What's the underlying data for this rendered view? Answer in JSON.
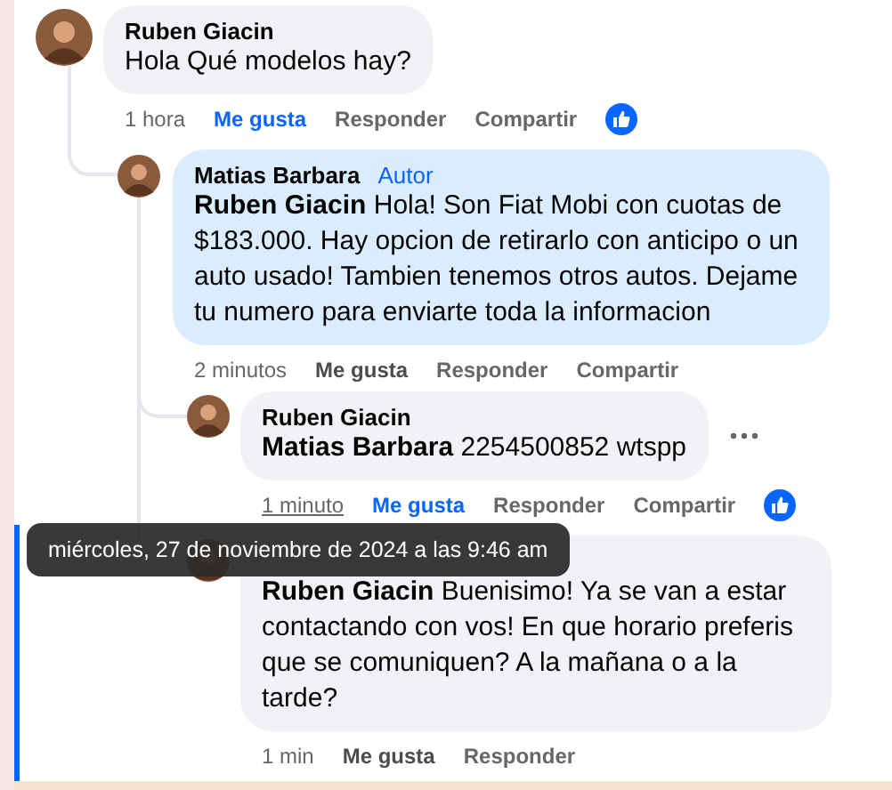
{
  "comments": [
    {
      "author": "Ruben Giacin",
      "text": "Hola Qué modelos hay?",
      "highlighted": false,
      "time": "1 hora",
      "time_hovered": false,
      "actions": [
        {
          "label": "Me gusta",
          "kind": "like",
          "active": true
        },
        {
          "label": "Responder",
          "kind": "reply"
        },
        {
          "label": "Compartir",
          "kind": "share"
        }
      ],
      "reaction": true,
      "menu": false,
      "focused": false,
      "children": [
        {
          "author": "Matias Barbara",
          "badge": "Autor",
          "text": "**Ruben Giacin** Hola! Son Fiat Mobi con cuotas de $183.000. Hay opcion de retirarlo con anticipo o un auto usado! Tambien tenemos otros autos. Dejame tu numero para enviarte toda la informacion",
          "highlighted": true,
          "time": "2 minutos",
          "time_hovered": false,
          "actions": [
            {
              "label": "Me gusta",
              "kind": "like",
              "active": false
            },
            {
              "label": "Responder",
              "kind": "reply"
            },
            {
              "label": "Compartir",
              "kind": "share"
            }
          ],
          "reaction": false,
          "menu": false,
          "focused": false,
          "children": [
            {
              "author": "Ruben Giacin",
              "text": "**Matias Barbara** 2254500852 wtspp",
              "highlighted": false,
              "time": "1 minuto",
              "time_hovered": true,
              "actions": [
                {
                  "label": "Me gusta",
                  "kind": "like",
                  "active": true
                },
                {
                  "label": "Responder",
                  "kind": "reply"
                },
                {
                  "label": "Compartir",
                  "kind": "share"
                }
              ],
              "reaction": true,
              "menu": true,
              "focused": false
            },
            {
              "text": "**Ruben Giacin** Buenisimo! Ya se van a estar contactando con vos! En que horario preferis que se comuniquen? A la mañana o a la tarde?",
              "highlighted": false,
              "time": "1 min",
              "time_hovered": false,
              "actions": [
                {
                  "label": "Me gusta",
                  "kind": "like",
                  "active": false
                },
                {
                  "label": "Responder",
                  "kind": "reply"
                }
              ],
              "reaction": false,
              "menu": false,
              "focused": true
            }
          ]
        }
      ]
    }
  ],
  "tooltip": "miércoles, 27 de noviembre de 2024 a las 9:46 am"
}
